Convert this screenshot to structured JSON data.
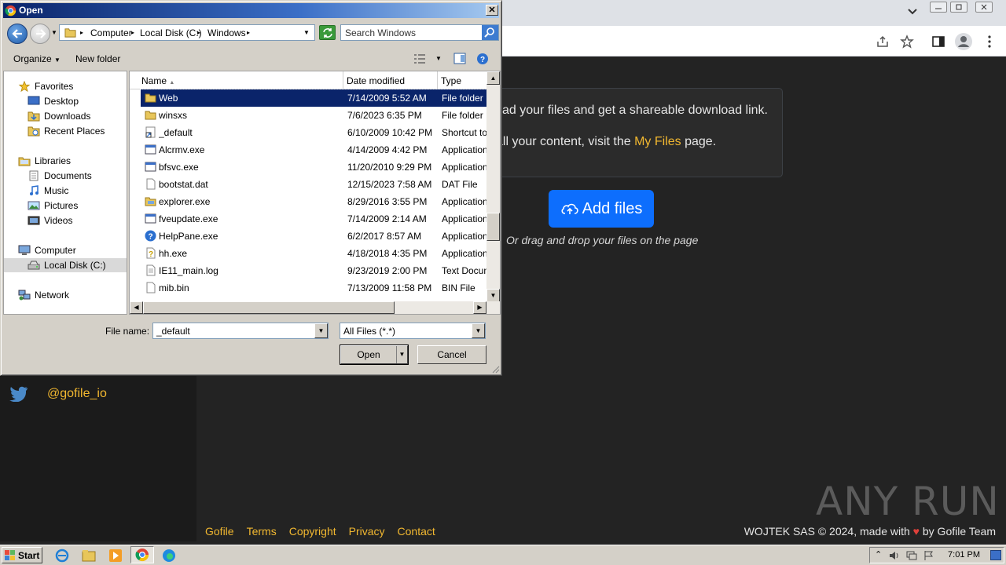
{
  "dialog": {
    "title": "Open",
    "breadcrumbs": [
      "Computer",
      "Local Disk (C:)",
      "Windows"
    ],
    "search_placeholder": "Search Windows",
    "organize_label": "Organize",
    "new_folder_label": "New folder",
    "nav": {
      "favorites": "Favorites",
      "desktop": "Desktop",
      "downloads": "Downloads",
      "recent_places": "Recent Places",
      "libraries": "Libraries",
      "documents": "Documents",
      "music": "Music",
      "pictures": "Pictures",
      "videos": "Videos",
      "computer": "Computer",
      "local_disk": "Local Disk (C:)",
      "network": "Network"
    },
    "columns": {
      "name": "Name",
      "date": "Date modified",
      "type": "Type"
    },
    "files": [
      {
        "name": "Web",
        "date": "7/14/2009 5:52 AM",
        "type": "File folder",
        "icon": "folder-icon"
      },
      {
        "name": "winsxs",
        "date": "7/6/2023 6:35 PM",
        "type": "File folder",
        "icon": "folder-icon"
      },
      {
        "name": "_default",
        "date": "6/10/2009 10:42 PM",
        "type": "Shortcut to I",
        "icon": "shortcut-icon"
      },
      {
        "name": "Alcrmv.exe",
        "date": "4/14/2009 4:42 PM",
        "type": "Application",
        "icon": "app-icon"
      },
      {
        "name": "bfsvc.exe",
        "date": "11/20/2010 9:29 PM",
        "type": "Application",
        "icon": "app-icon"
      },
      {
        "name": "bootstat.dat",
        "date": "12/15/2023 7:58 AM",
        "type": "DAT File",
        "icon": "file-icon"
      },
      {
        "name": "explorer.exe",
        "date": "8/29/2016 3:55 PM",
        "type": "Application",
        "icon": "explorer-icon"
      },
      {
        "name": "fveupdate.exe",
        "date": "7/14/2009 2:14 AM",
        "type": "Application",
        "icon": "app-icon"
      },
      {
        "name": "HelpPane.exe",
        "date": "6/2/2017 8:57 AM",
        "type": "Application",
        "icon": "help-icon"
      },
      {
        "name": "hh.exe",
        "date": "4/18/2018 4:35 PM",
        "type": "Application",
        "icon": "help-doc-icon"
      },
      {
        "name": "IE11_main.log",
        "date": "9/23/2019 2:00 PM",
        "type": "Text Docume",
        "icon": "text-file-icon"
      },
      {
        "name": "mib.bin",
        "date": "7/13/2009 11:58 PM",
        "type": "BIN File",
        "icon": "file-icon"
      }
    ],
    "file_name_label": "File name:",
    "file_name_value": "_default",
    "file_type_value": "All Files (*.*)",
    "open_label": "Open",
    "cancel_label": "Cancel"
  },
  "page": {
    "info_line1": "ad your files and get a shareable download link.",
    "info_line2_pre": "all your content, visit the ",
    "info_line2_link": "My Files",
    "info_line2_post": " page.",
    "add_files_label": "Add files",
    "drag_hint": "Or drag and drop your files on the page",
    "twitter_handle": "@gofile_io",
    "footer_links": [
      "Gofile",
      "Terms",
      "Copyright",
      "Privacy",
      "Contact"
    ],
    "footer_right_pre": "WOJTEK SAS © 2024, made with ",
    "footer_heart": "♥",
    "footer_right_post": " by Gofile Team",
    "watermark": "ANY RUN"
  },
  "taskbar": {
    "start_label": "Start",
    "clock": "7:01 PM"
  },
  "colors": {
    "accent_blue": "#0d6efd",
    "link_yellow": "#f2b830",
    "selection": "#0a246a"
  }
}
